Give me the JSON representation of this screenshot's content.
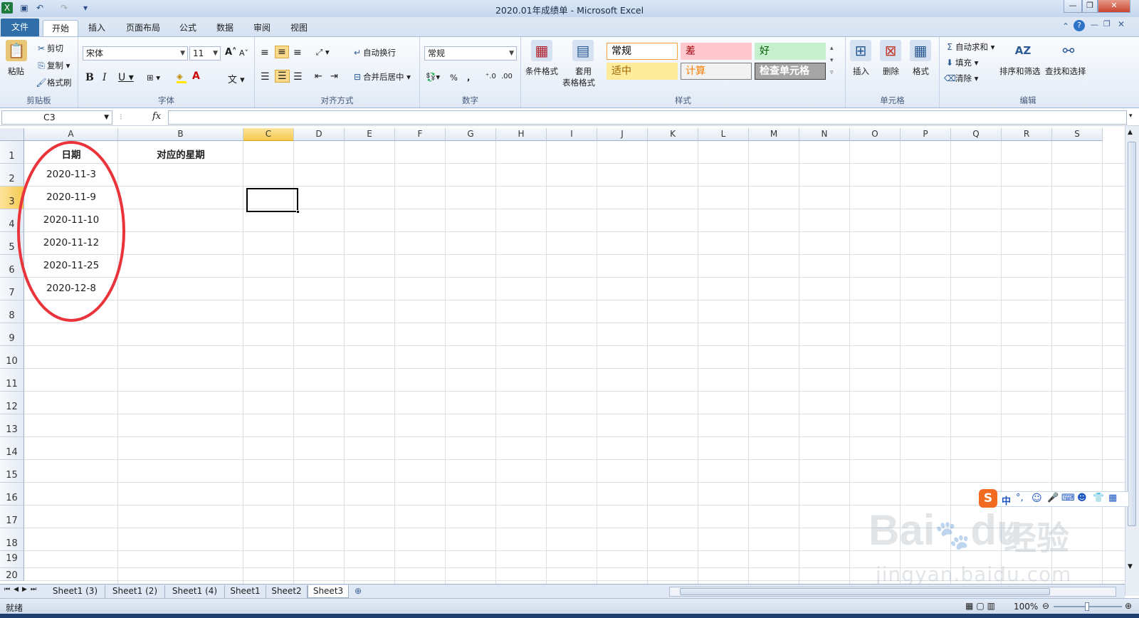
{
  "window": {
    "title": "2020.01年成绩单 - Microsoft Excel"
  },
  "tabs": [
    "文件",
    "开始",
    "插入",
    "页面布局",
    "公式",
    "数据",
    "审阅",
    "视图"
  ],
  "ribbon": {
    "clipboard": {
      "paste": "粘贴",
      "cut": "剪切",
      "copy": "复制",
      "format_painter": "格式刷",
      "label": "剪贴板"
    },
    "font": {
      "name": "宋体",
      "size": "11",
      "label": "字体"
    },
    "alignment": {
      "wrap": "自动换行",
      "merge": "合并后居中",
      "label": "对齐方式"
    },
    "number": {
      "format": "常规",
      "label": "数字"
    },
    "styles": {
      "cond_format": "条件格式",
      "table_format": "套用",
      "table_format2": "表格格式",
      "label": "样式",
      "cells": [
        {
          "text": "常规",
          "bg": "#ffffff",
          "fg": "#000000",
          "border": "#f3a33b"
        },
        {
          "text": "差",
          "bg": "#ffc7ce",
          "fg": "#9c0006",
          "border": "#ffc7ce"
        },
        {
          "text": "好",
          "bg": "#c6efce",
          "fg": "#006100",
          "border": "#c6efce"
        },
        {
          "text": "适中",
          "bg": "#ffeb9c",
          "fg": "#9c6500",
          "border": "#ffeb9c"
        },
        {
          "text": "计算",
          "bg": "#f2f2f2",
          "fg": "#fa7d00",
          "border": "#7f7f7f"
        },
        {
          "text": "检查单元格",
          "bg": "#a5a5a5",
          "fg": "#ffffff",
          "border": "#3f3f3f"
        }
      ]
    },
    "cells": {
      "insert": "插入",
      "delete": "删除",
      "format": "格式",
      "label": "单元格"
    },
    "editing": {
      "autosum": "自动求和",
      "fill": "填充",
      "clear": "清除",
      "sort": "排序和筛选",
      "find": "查找和选择",
      "label": "编辑"
    }
  },
  "formula_bar": {
    "name_box": "C3",
    "fx": "fx"
  },
  "columns": [
    "A",
    "B",
    "C",
    "D",
    "E",
    "F",
    "G",
    "H",
    "I",
    "J",
    "K",
    "L",
    "M",
    "N",
    "O",
    "P",
    "Q",
    "R",
    "S"
  ],
  "rows": [
    "1",
    "2",
    "3",
    "4",
    "5",
    "6",
    "7",
    "8",
    "9",
    "10",
    "11",
    "12",
    "13",
    "14",
    "15",
    "16",
    "17",
    "18",
    "19",
    "20"
  ],
  "cells": {
    "A1": "日期",
    "B1": "对应的星期",
    "A2": "2020-11-3",
    "A3": "2020-11-9",
    "A4": "2020-11-10",
    "A5": "2020-11-12",
    "A6": "2020-11-25",
    "A7": "2020-12-8"
  },
  "selected_cell": "C3",
  "sheets": [
    "Sheet1 (3)",
    "Sheet1 (2)",
    "Sheet1 (4)",
    "Sheet1",
    "Sheet2",
    "Sheet3"
  ],
  "active_sheet": "Sheet3",
  "status": {
    "ready": "就绪",
    "zoom": "100%"
  },
  "ime": {
    "lang": "中"
  },
  "watermark": {
    "brand": "Bai",
    "brand2": "du",
    "cn": "经验",
    "url": "jingyan.baidu.com"
  },
  "annotation_color": "#e8343a"
}
